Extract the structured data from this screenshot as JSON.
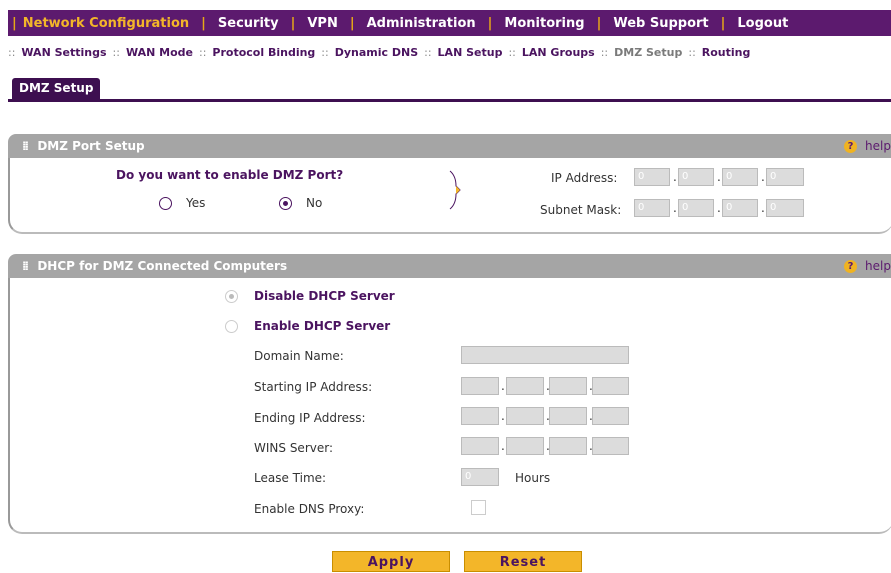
{
  "top_nav": {
    "items": [
      "Network Configuration",
      "Security",
      "VPN",
      "Administration",
      "Monitoring",
      "Web Support",
      "Logout"
    ],
    "active_index": 0
  },
  "sub_nav": {
    "items": [
      "WAN Settings",
      "WAN Mode",
      "Protocol Binding",
      "Dynamic DNS",
      "LAN Setup",
      "LAN Groups",
      "DMZ Setup",
      "Routing"
    ],
    "active_index": 6
  },
  "tab": {
    "label": "DMZ Setup"
  },
  "dmz_port_setup": {
    "title": "DMZ Port Setup",
    "help_label": "help",
    "question": "Do you want to enable DMZ Port?",
    "yes_label": "Yes",
    "no_label": "No",
    "selected": "No",
    "ip_address_label": "IP Address:",
    "ip_address": [
      "0",
      "0",
      "0",
      "0"
    ],
    "subnet_mask_label": "Subnet Mask:",
    "subnet_mask": [
      "0",
      "0",
      "0",
      "0"
    ]
  },
  "dhcp_section": {
    "title": "DHCP for DMZ Connected Computers",
    "help_label": "help",
    "disable_label": "Disable DHCP Server",
    "enable_label": "Enable DHCP Server",
    "selected": "Disable DHCP Server",
    "domain_name_label": "Domain Name:",
    "domain_name": "",
    "starting_ip_label": "Starting IP Address:",
    "starting_ip": [
      "",
      "",
      "",
      ""
    ],
    "ending_ip_label": "Ending IP Address:",
    "ending_ip": [
      "",
      "",
      "",
      ""
    ],
    "wins_label": "WINS Server:",
    "wins": [
      "",
      "",
      "",
      ""
    ],
    "lease_time_label": "Lease Time:",
    "lease_time": "0",
    "lease_unit": "Hours",
    "dns_proxy_label": "Enable DNS Proxy:",
    "dns_proxy_checked": false
  },
  "buttons": {
    "apply": "Apply",
    "reset": "Reset"
  },
  "colors": {
    "nav_bg": "#5c1a6e",
    "accent": "#f3b629",
    "section_header": "#a5a5a5"
  }
}
